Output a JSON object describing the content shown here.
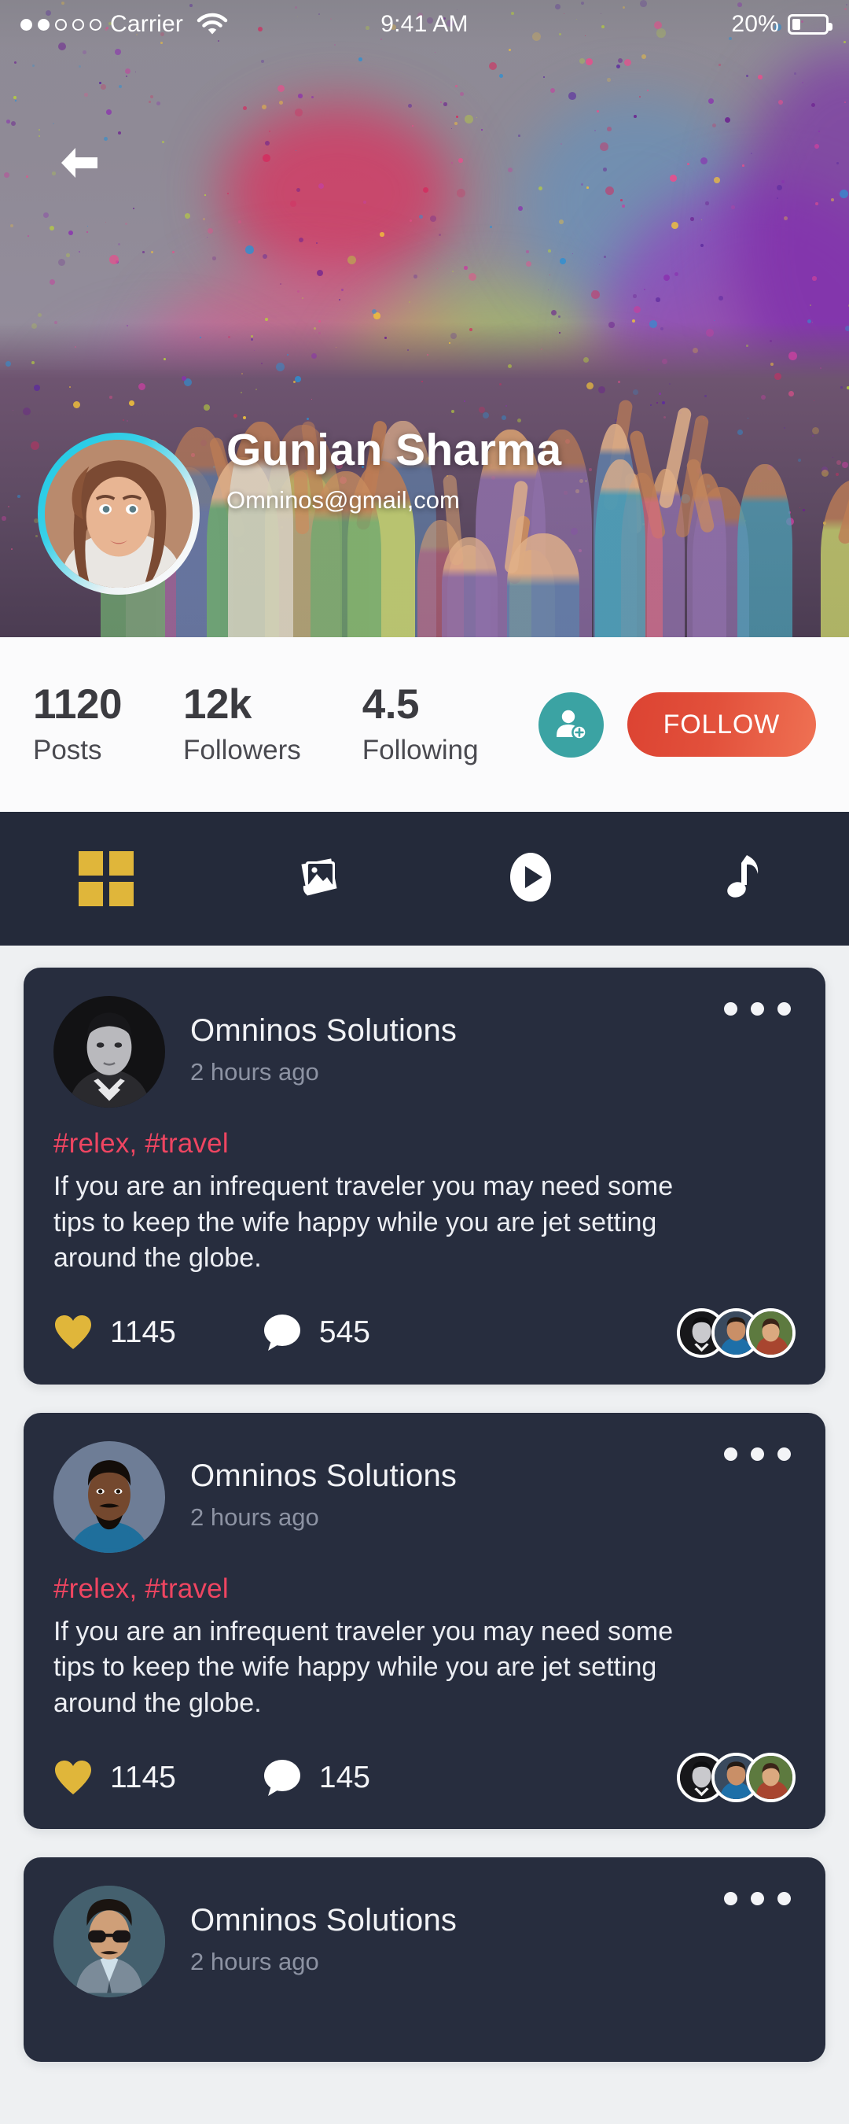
{
  "status_bar": {
    "signal_dots_filled": 2,
    "signal_dots_total": 5,
    "carrier": "Carrier",
    "wifi_icon": "wifi-icon",
    "time": "9:41 AM",
    "battery_percent": "20%",
    "battery_level": 0.26
  },
  "header": {
    "back_icon": "back-arrow-icon",
    "name": "Gunjan Sharma",
    "email": "Omninos@gmail,com",
    "avatar": "profile-avatar"
  },
  "stats": {
    "items": [
      {
        "value": "1120",
        "label": "Posts"
      },
      {
        "value": "12k",
        "label": "Followers"
      },
      {
        "value": "4.5",
        "label": "Following"
      }
    ],
    "add_friend_icon": "add-person-icon",
    "follow_label": "FOLLOW",
    "follow_color_start": "#dc4332",
    "follow_color_end": "#ef7153",
    "add_button_color": "#3ba3a3"
  },
  "tabs": [
    {
      "icon": "grid-icon",
      "active": true,
      "color": "#e0b63a"
    },
    {
      "icon": "photo-icon",
      "active": false,
      "color": "#ffffff"
    },
    {
      "icon": "play-icon",
      "active": false,
      "color": "#ffffff"
    },
    {
      "icon": "music-note-icon",
      "active": false,
      "color": "#ffffff"
    }
  ],
  "feed": {
    "posts": [
      {
        "author": "Omninos Solutions",
        "time": "2 hours ago",
        "tags": "#relex, #travel",
        "body": "If you are an infrequent traveler you may need some tips to keep the wife happy while you are jet setting around the globe.",
        "likes": "1145",
        "comments": "545",
        "more_icon": "more-options-icon",
        "like_icon": "heart-icon",
        "comment_icon": "comment-bubble-icon"
      },
      {
        "author": "Omninos Solutions",
        "time": "2 hours ago",
        "tags": "#relex, #travel",
        "body": "If you are an infrequent traveler you may need some tips to keep the wife happy while you are jet setting around the globe.",
        "likes": "1145",
        "comments": "145",
        "more_icon": "more-options-icon",
        "like_icon": "heart-icon",
        "comment_icon": "comment-bubble-icon"
      },
      {
        "author": "Omninos Solutions",
        "time": "2 hours ago",
        "tags": "",
        "body": "",
        "likes": "",
        "comments": "",
        "more_icon": "more-options-icon",
        "like_icon": "heart-icon",
        "comment_icon": "comment-bubble-icon"
      }
    ]
  },
  "theme": {
    "page_bg": "#eef0f2",
    "card_bg": "#272d3e",
    "tabbar_bg": "#242a3a",
    "tag_color": "#ef4561",
    "heart_color": "#e0b63a"
  }
}
